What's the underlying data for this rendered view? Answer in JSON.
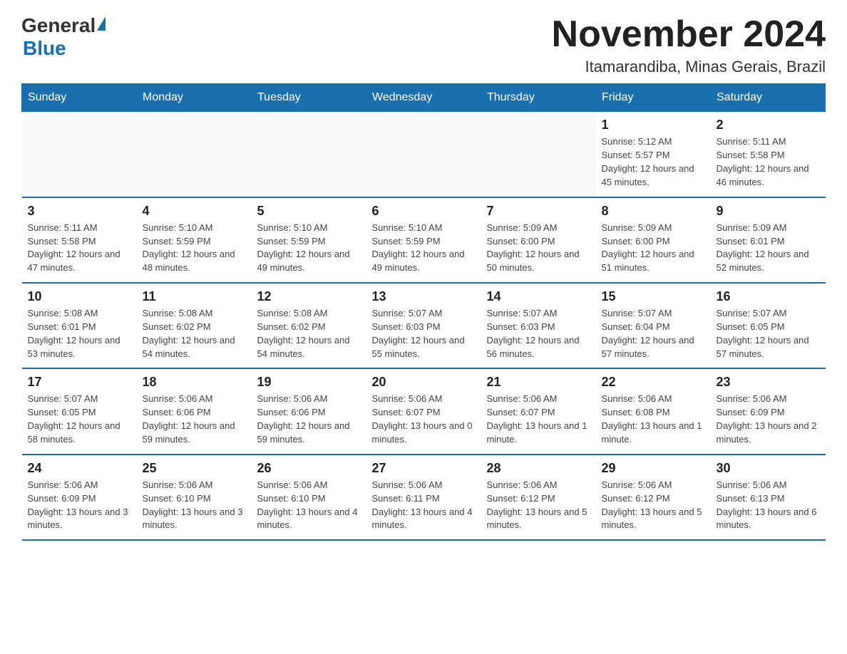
{
  "header": {
    "logo_general": "General",
    "logo_blue": "Blue",
    "month_title": "November 2024",
    "location": "Itamarandiba, Minas Gerais, Brazil"
  },
  "weekdays": [
    "Sunday",
    "Monday",
    "Tuesday",
    "Wednesday",
    "Thursday",
    "Friday",
    "Saturday"
  ],
  "weeks": [
    [
      {
        "day": "",
        "info": ""
      },
      {
        "day": "",
        "info": ""
      },
      {
        "day": "",
        "info": ""
      },
      {
        "day": "",
        "info": ""
      },
      {
        "day": "",
        "info": ""
      },
      {
        "day": "1",
        "info": "Sunrise: 5:12 AM\nSunset: 5:57 PM\nDaylight: 12 hours and 45 minutes."
      },
      {
        "day": "2",
        "info": "Sunrise: 5:11 AM\nSunset: 5:58 PM\nDaylight: 12 hours and 46 minutes."
      }
    ],
    [
      {
        "day": "3",
        "info": "Sunrise: 5:11 AM\nSunset: 5:58 PM\nDaylight: 12 hours and 47 minutes."
      },
      {
        "day": "4",
        "info": "Sunrise: 5:10 AM\nSunset: 5:59 PM\nDaylight: 12 hours and 48 minutes."
      },
      {
        "day": "5",
        "info": "Sunrise: 5:10 AM\nSunset: 5:59 PM\nDaylight: 12 hours and 49 minutes."
      },
      {
        "day": "6",
        "info": "Sunrise: 5:10 AM\nSunset: 5:59 PM\nDaylight: 12 hours and 49 minutes."
      },
      {
        "day": "7",
        "info": "Sunrise: 5:09 AM\nSunset: 6:00 PM\nDaylight: 12 hours and 50 minutes."
      },
      {
        "day": "8",
        "info": "Sunrise: 5:09 AM\nSunset: 6:00 PM\nDaylight: 12 hours and 51 minutes."
      },
      {
        "day": "9",
        "info": "Sunrise: 5:09 AM\nSunset: 6:01 PM\nDaylight: 12 hours and 52 minutes."
      }
    ],
    [
      {
        "day": "10",
        "info": "Sunrise: 5:08 AM\nSunset: 6:01 PM\nDaylight: 12 hours and 53 minutes."
      },
      {
        "day": "11",
        "info": "Sunrise: 5:08 AM\nSunset: 6:02 PM\nDaylight: 12 hours and 54 minutes."
      },
      {
        "day": "12",
        "info": "Sunrise: 5:08 AM\nSunset: 6:02 PM\nDaylight: 12 hours and 54 minutes."
      },
      {
        "day": "13",
        "info": "Sunrise: 5:07 AM\nSunset: 6:03 PM\nDaylight: 12 hours and 55 minutes."
      },
      {
        "day": "14",
        "info": "Sunrise: 5:07 AM\nSunset: 6:03 PM\nDaylight: 12 hours and 56 minutes."
      },
      {
        "day": "15",
        "info": "Sunrise: 5:07 AM\nSunset: 6:04 PM\nDaylight: 12 hours and 57 minutes."
      },
      {
        "day": "16",
        "info": "Sunrise: 5:07 AM\nSunset: 6:05 PM\nDaylight: 12 hours and 57 minutes."
      }
    ],
    [
      {
        "day": "17",
        "info": "Sunrise: 5:07 AM\nSunset: 6:05 PM\nDaylight: 12 hours and 58 minutes."
      },
      {
        "day": "18",
        "info": "Sunrise: 5:06 AM\nSunset: 6:06 PM\nDaylight: 12 hours and 59 minutes."
      },
      {
        "day": "19",
        "info": "Sunrise: 5:06 AM\nSunset: 6:06 PM\nDaylight: 12 hours and 59 minutes."
      },
      {
        "day": "20",
        "info": "Sunrise: 5:06 AM\nSunset: 6:07 PM\nDaylight: 13 hours and 0 minutes."
      },
      {
        "day": "21",
        "info": "Sunrise: 5:06 AM\nSunset: 6:07 PM\nDaylight: 13 hours and 1 minute."
      },
      {
        "day": "22",
        "info": "Sunrise: 5:06 AM\nSunset: 6:08 PM\nDaylight: 13 hours and 1 minute."
      },
      {
        "day": "23",
        "info": "Sunrise: 5:06 AM\nSunset: 6:09 PM\nDaylight: 13 hours and 2 minutes."
      }
    ],
    [
      {
        "day": "24",
        "info": "Sunrise: 5:06 AM\nSunset: 6:09 PM\nDaylight: 13 hours and 3 minutes."
      },
      {
        "day": "25",
        "info": "Sunrise: 5:06 AM\nSunset: 6:10 PM\nDaylight: 13 hours and 3 minutes."
      },
      {
        "day": "26",
        "info": "Sunrise: 5:06 AM\nSunset: 6:10 PM\nDaylight: 13 hours and 4 minutes."
      },
      {
        "day": "27",
        "info": "Sunrise: 5:06 AM\nSunset: 6:11 PM\nDaylight: 13 hours and 4 minutes."
      },
      {
        "day": "28",
        "info": "Sunrise: 5:06 AM\nSunset: 6:12 PM\nDaylight: 13 hours and 5 minutes."
      },
      {
        "day": "29",
        "info": "Sunrise: 5:06 AM\nSunset: 6:12 PM\nDaylight: 13 hours and 5 minutes."
      },
      {
        "day": "30",
        "info": "Sunrise: 5:06 AM\nSunset: 6:13 PM\nDaylight: 13 hours and 6 minutes."
      }
    ]
  ]
}
